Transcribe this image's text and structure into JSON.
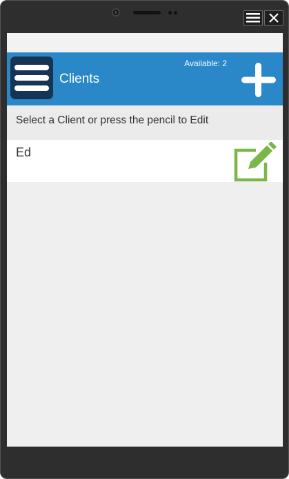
{
  "window": {
    "menu_icon": "hamburger-icon",
    "close_icon": "close-x-icon"
  },
  "header": {
    "title": "Clients",
    "available_label": "Available: 2",
    "menu_icon": "hamburger-menu-icon",
    "add_icon": "plus-icon",
    "background_color": "#2a88c8"
  },
  "instruction": {
    "text": "Select a Client or press the pencil to Edit"
  },
  "clients": [
    {
      "name": "Ed",
      "edit_icon": "pencil-edit-icon",
      "edit_icon_color": "#7ab648"
    }
  ]
}
